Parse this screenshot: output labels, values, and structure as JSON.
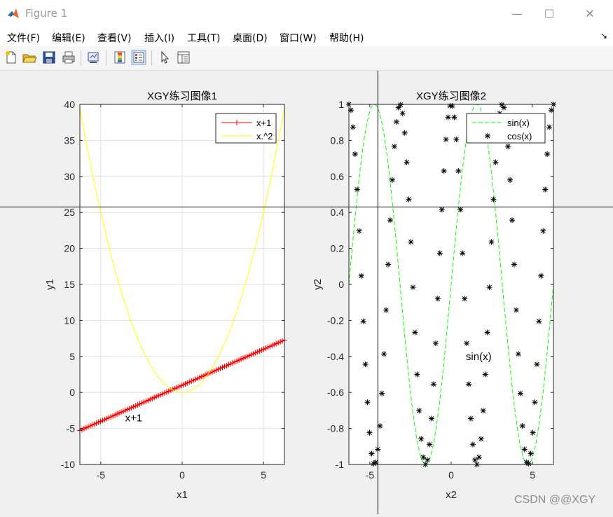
{
  "window": {
    "title": "Figure 1",
    "min_glyph": "—",
    "max_glyph": "☐",
    "close_glyph": "✕"
  },
  "menu": [
    "文件(F)",
    "编辑(E)",
    "查看(V)",
    "插入(I)",
    "工具(T)",
    "桌面(D)",
    "窗口(W)",
    "帮助(H)"
  ],
  "menu_arrow": "↘",
  "toolbar_icons": [
    "new-figure-icon",
    "open-icon",
    "save-icon",
    "print-icon",
    "link-icon",
    "colorbar-icon",
    "legend-icon",
    "pointer-icon",
    "property-editor-icon"
  ],
  "watermark": "CSDN @@XGY",
  "colors": {
    "line1": "#ff0000",
    "line2": "#ffff00",
    "sin": "#00ff00",
    "cos": "#000000"
  },
  "chart_data": [
    {
      "type": "line",
      "title": "XGY练习图像1",
      "xlabel": "x1",
      "ylabel": "y1",
      "xlim": [
        -6.2832,
        6.2832
      ],
      "ylim": [
        -10,
        40
      ],
      "xticks": [
        -5,
        0,
        5
      ],
      "yticks": [
        -10,
        -5,
        0,
        5,
        10,
        15,
        20,
        25,
        30,
        35,
        40
      ],
      "grid": true,
      "legend_placement": "top-right",
      "series": [
        {
          "name": "x+1",
          "function": "x+1",
          "marker": "+",
          "color": "#ff0000",
          "samples": 100
        },
        {
          "name": "x.^2",
          "function": "x^2",
          "marker": "none",
          "color": "#ffff00",
          "samples": 100
        }
      ],
      "annotations": [
        {
          "text": "x+1",
          "x": -3.5,
          "y": -4
        }
      ]
    },
    {
      "type": "line",
      "title": "XGY练习图像2",
      "xlabel": "x2",
      "ylabel": "y2",
      "xlim": [
        -6.2832,
        6.2832
      ],
      "ylim": [
        -1,
        1
      ],
      "xticks": [
        -5,
        0,
        5
      ],
      "yticks": [
        -1,
        -0.8,
        -0.6,
        -0.4,
        -0.2,
        0,
        0.2,
        0.4,
        0.6,
        0.8,
        1
      ],
      "grid": false,
      "legend_placement": "top-right",
      "series": [
        {
          "name": "sin(x)",
          "function": "sin(x)",
          "style": "dashed",
          "color": "#00ff00",
          "samples": 200
        },
        {
          "name": "cos(x)",
          "function": "cos(2x)",
          "marker": "*",
          "color": "#000000",
          "samples": 100
        }
      ],
      "annotations": [
        {
          "text": "sin(x)",
          "x": 0.9,
          "y": -0.42
        }
      ],
      "crosshair": {
        "x": -4.5,
        "y": 0.43
      }
    }
  ]
}
